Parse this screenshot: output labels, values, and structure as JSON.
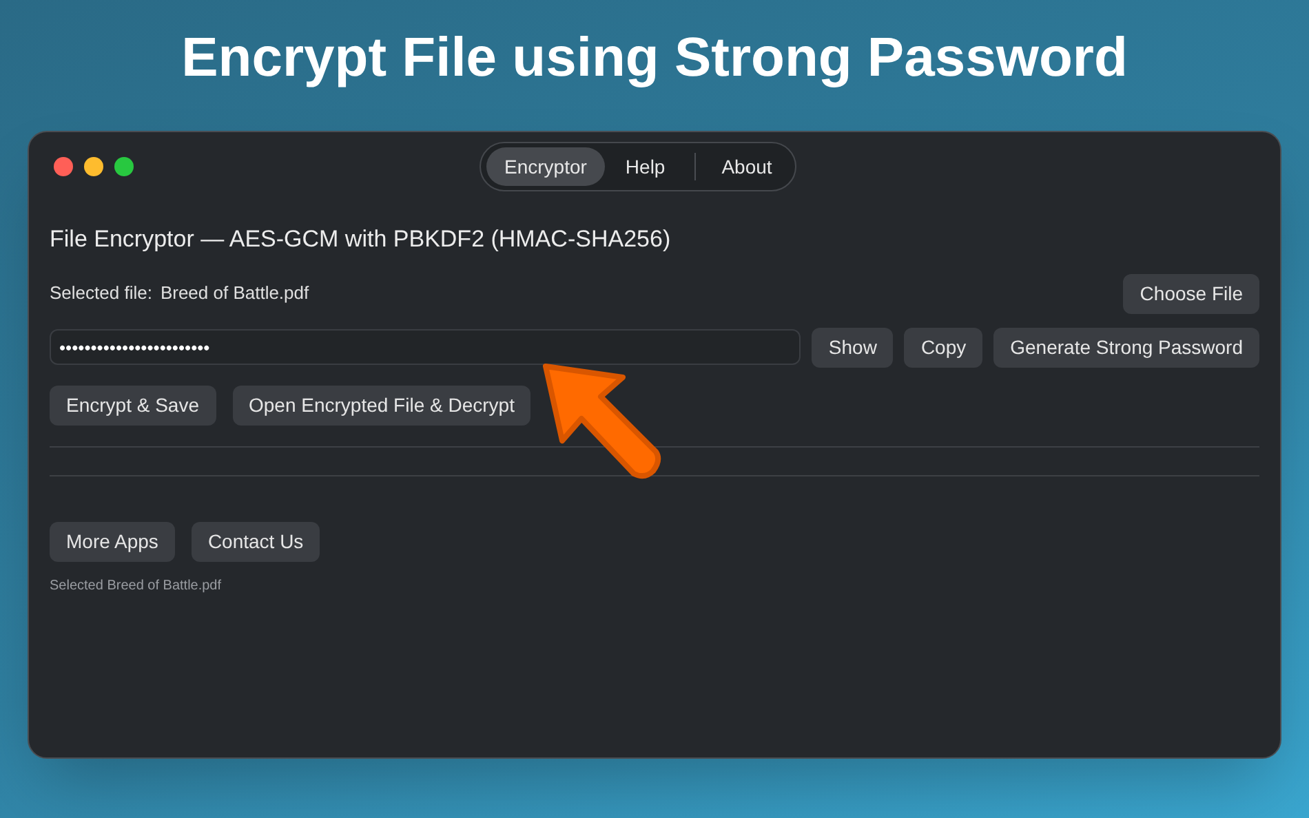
{
  "headline": "Encrypt File using Strong Password",
  "tabs": [
    {
      "label": "Encryptor",
      "selected": true
    },
    {
      "label": "Help",
      "selected": false
    },
    {
      "label": "About",
      "selected": false
    }
  ],
  "heading": "File Encryptor — AES-GCM with PBKDF2 (HMAC-SHA256)",
  "selected_file": {
    "label": "Selected file:",
    "value": "Breed of Battle.pdf"
  },
  "choose_button": "Choose File",
  "password": {
    "value": "••••••••••••••••••••••••"
  },
  "password_buttons": [
    "Show",
    "Copy",
    "Generate Strong Password"
  ],
  "action_buttons": [
    "Encrypt & Save",
    "Open Encrypted File & Decrypt"
  ],
  "footer_buttons": [
    "More Apps",
    "Contact Us"
  ],
  "status": "Selected Breed of Battle.pdf"
}
